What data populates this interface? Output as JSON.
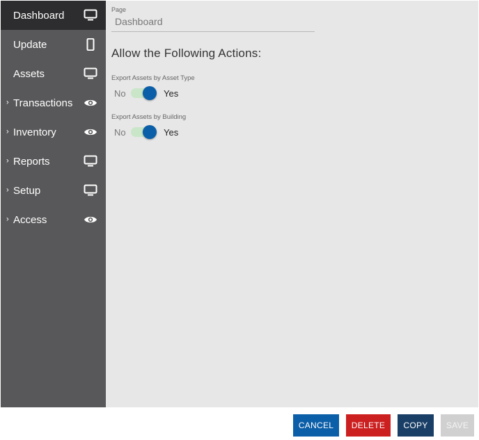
{
  "sidebar": {
    "items": [
      {
        "label": "Dashboard",
        "icon": "monitor-icon",
        "expandable": false,
        "active": true
      },
      {
        "label": "Update",
        "icon": "mobile-icon",
        "expandable": false,
        "active": false
      },
      {
        "label": "Assets",
        "icon": "monitor-icon",
        "expandable": false,
        "active": false
      },
      {
        "label": "Transactions",
        "icon": "eye-icon",
        "expandable": true,
        "active": false
      },
      {
        "label": "Inventory",
        "icon": "eye-icon",
        "expandable": true,
        "active": false
      },
      {
        "label": "Reports",
        "icon": "monitor-icon",
        "expandable": true,
        "active": false
      },
      {
        "label": "Setup",
        "icon": "monitor-icon",
        "expandable": true,
        "active": false
      },
      {
        "label": "Access",
        "icon": "eye-icon",
        "expandable": true,
        "active": false
      }
    ]
  },
  "main": {
    "page_label": "Page",
    "page_value": "Dashboard",
    "section_title": "Allow the Following Actions:",
    "permissions": [
      {
        "label": "Export Assets by Asset Type",
        "off_text": "No",
        "on_text": "Yes",
        "enabled": true
      },
      {
        "label": "Export Assets by Building",
        "off_text": "No",
        "on_text": "Yes",
        "enabled": true
      }
    ]
  },
  "footer": {
    "cancel_label": "CANCEL",
    "delete_label": "DELETE",
    "copy_label": "COPY",
    "save_label": "SAVE"
  },
  "colors": {
    "sidebar_bg": "#58585a",
    "sidebar_active": "#2d2d2f",
    "main_bg": "#e7e7e7",
    "toggle_on": "#0b5ea8",
    "cancel": "#0b5ea8",
    "delete": "#cc1f1f",
    "copy": "#1a3f66",
    "save_disabled": "#d0d0d0"
  }
}
